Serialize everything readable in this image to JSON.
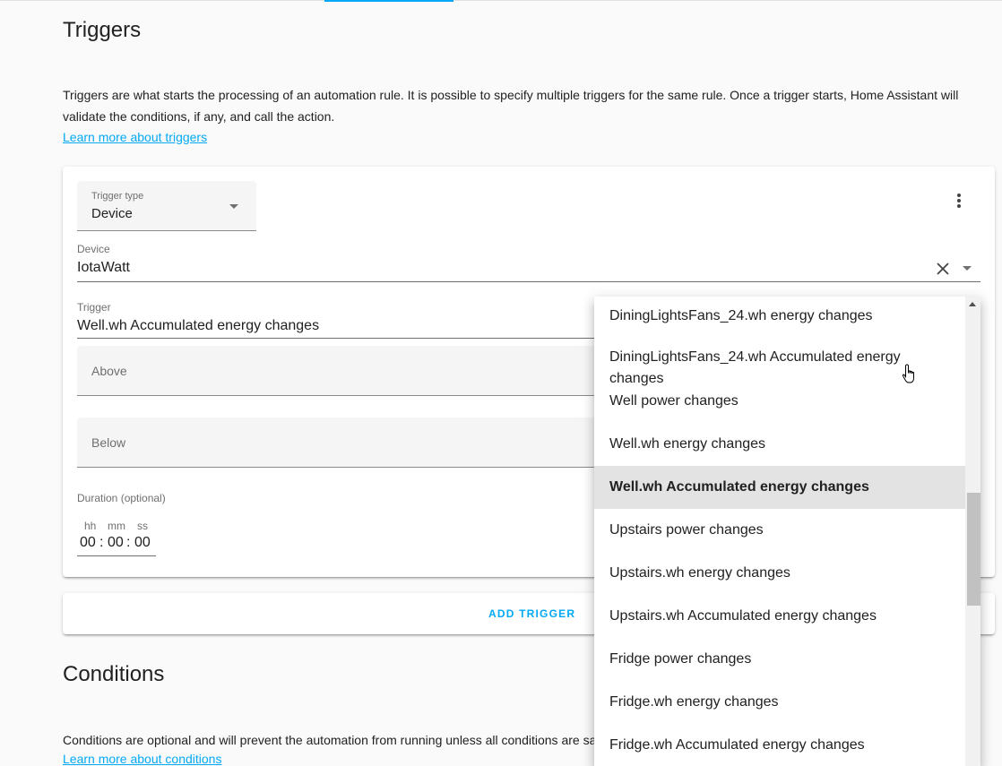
{
  "triggers_section": {
    "title": "Triggers",
    "description": "Triggers are what starts the processing of an automation rule. It is possible to specify multiple triggers for the same rule. Once a trigger starts, Home Assistant will validate the conditions, if any, and call the action.",
    "learn_more": "Learn more about triggers"
  },
  "trigger_card": {
    "trigger_type": {
      "label": "Trigger type",
      "value": "Device"
    },
    "device": {
      "label": "Device",
      "value": "IotaWatt"
    },
    "trigger": {
      "label": "Trigger",
      "value": "Well.wh Accumulated energy changes"
    },
    "above": {
      "label": "Above"
    },
    "below": {
      "label": "Below"
    },
    "duration": {
      "label": "Duration (optional)",
      "units": [
        "hh",
        "mm",
        "ss"
      ],
      "values": [
        "00",
        "00",
        "00"
      ],
      "separator": ":"
    }
  },
  "add_trigger": {
    "label": "ADD TRIGGER"
  },
  "conditions_section": {
    "title": "Conditions",
    "description": "Conditions are optional and will prevent the automation from running unless all conditions are sa",
    "learn_more": "Learn more about conditions"
  },
  "trigger_dropdown": {
    "options": [
      {
        "line1": "DiningLightsFans_24.wh energy changes",
        "line2": ""
      },
      {
        "line1": "DiningLightsFans_24.wh Accumulated energy",
        "line2": "changes"
      },
      {
        "line1": "Well power changes",
        "line2": ""
      },
      {
        "line1": "Well.wh energy changes",
        "line2": ""
      },
      {
        "line1": "Well.wh Accumulated energy changes",
        "line2": ""
      },
      {
        "line1": "Upstairs power changes",
        "line2": ""
      },
      {
        "line1": "Upstairs.wh energy changes",
        "line2": ""
      },
      {
        "line1": "Upstairs.wh Accumulated energy changes",
        "line2": ""
      },
      {
        "line1": "Fridge power changes",
        "line2": ""
      },
      {
        "line1": "Fridge.wh energy changes",
        "line2": ""
      },
      {
        "line1": "Fridge.wh Accumulated energy changes",
        "line2": ""
      }
    ],
    "selected_index": 4
  },
  "colors": {
    "accent": "#03a9f4",
    "selected_bg": "#e3e3e3"
  }
}
